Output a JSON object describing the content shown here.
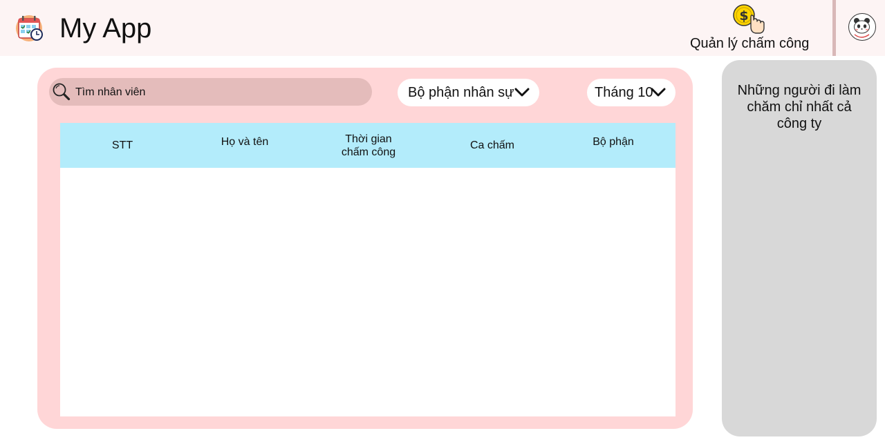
{
  "header": {
    "app_title": "My App",
    "logo_icon": "calendar-clock-icon",
    "nav_attendance_label": "Quản lý chấm công",
    "nav_attendance_icon": "coin-hand-icon",
    "avatar_icon": "panda-avatar-icon"
  },
  "filters": {
    "search_placeholder": "Tìm nhân viên",
    "department_selected": "Bộ phận nhân sự",
    "month_selected": "Tháng 10"
  },
  "table": {
    "columns": [
      {
        "line1": "STT",
        "line2": ""
      },
      {
        "line1": "Họ và tên",
        "line2": ""
      },
      {
        "line1": "Thời gian",
        "line2": "chấm công"
      },
      {
        "line1": "Ca chấm",
        "line2": ""
      },
      {
        "line1": "Bộ phận",
        "line2": ""
      }
    ],
    "rows": []
  },
  "sidebar": {
    "title_line1": "Những người đi làm",
    "title_line2": "chăm chỉ nhất cả",
    "title_line3": "công ty"
  },
  "colors": {
    "header_bg": "#fdf4f4",
    "main_panel_bg": "#ffd6d7",
    "search_bg": "#e4bcbb",
    "table_header_bg": "#b3ecfb",
    "side_panel_bg": "#d8d8d8",
    "divider": "#d9b8b8"
  }
}
